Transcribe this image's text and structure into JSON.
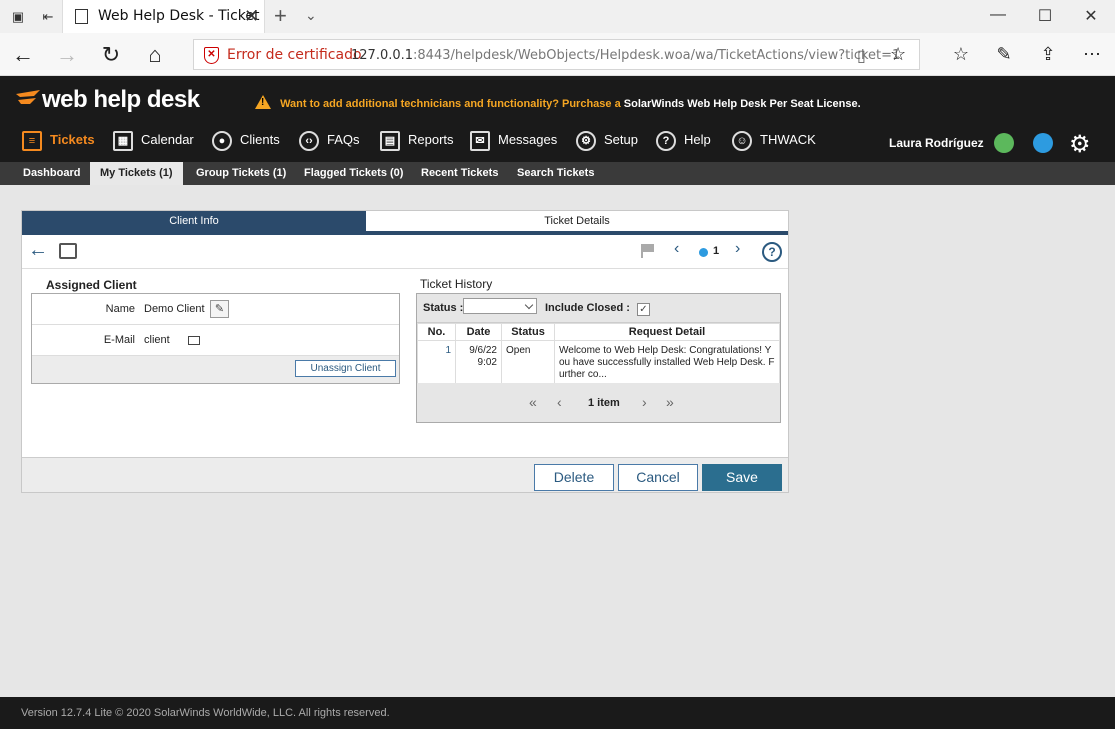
{
  "browser": {
    "tab_title": "Web Help Desk - Ticket",
    "cert_warning": "Error de certificado",
    "url_host": "127.0.0.1",
    "url_rest": ":8443/helpdesk/WebObjects/Helpdesk.woa/wa/TicketActions/view?ticket=1"
  },
  "app": {
    "logo": "web help desk",
    "promo_prefix": "Want to add additional technicians and functionality? Purchase a ",
    "promo_suffix": "SolarWinds Web Help Desk Per Seat License.",
    "nav": [
      "Tickets",
      "Calendar",
      "Clients",
      "FAQs",
      "Reports",
      "Messages",
      "Setup",
      "Help",
      "THWACK"
    ],
    "user_name": "Laura Rodríguez",
    "subnav": [
      "Dashboard",
      "My Tickets (1)",
      "Group Tickets (1)",
      "Flagged Tickets (0)",
      "Recent Tickets",
      "Search Tickets"
    ],
    "brand_color": "#f58a1f",
    "accent_color": "#2b4a6b"
  },
  "ticket": {
    "tabs": [
      "Client Info",
      "Ticket Details"
    ],
    "pager_current": "1",
    "assigned_client_title": "Assigned Client",
    "name_label": "Name",
    "name_value": "Demo Client",
    "email_label": "E-Mail",
    "email_value": "client",
    "unassign_label": "Unassign Client",
    "history_title": "Ticket History",
    "status_label": "Status :",
    "include_closed_label": "Include Closed :",
    "history_columns": [
      "No.",
      "Date",
      "Status",
      "Request Detail"
    ],
    "history_rows": [
      {
        "no": "1",
        "date_line1": "9/6/22",
        "date_line2": "9:02",
        "status": "Open",
        "detail": "Welcome to Web Help Desk: Congratulations! You have successfully installed Web Help Desk. Further co..."
      }
    ],
    "history_count": "1 item",
    "actions": [
      "Delete",
      "Cancel",
      "Save"
    ]
  },
  "footer": {
    "text": "Version 12.7.4 Lite © 2020 SolarWinds WorldWide, LLC. All rights reserved."
  }
}
